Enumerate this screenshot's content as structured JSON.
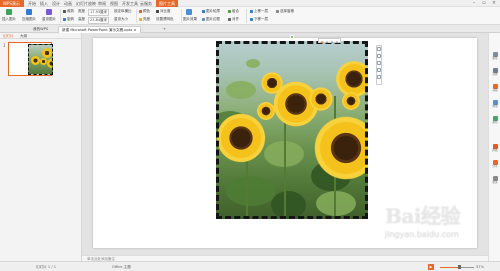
{
  "app": {
    "app_button": "WPS演示",
    "menu_tabs": [
      "开始",
      "插入",
      "设计",
      "动画",
      "幻灯片放映",
      "审阅",
      "视图",
      "开发工具",
      "云服务"
    ],
    "active_tab": "图片工具",
    "accent": "#e8682a"
  },
  "ribbon": {
    "insert_picture": "插入图片",
    "compress": "压缩图片",
    "reset": "重设图片",
    "crop": "裁剪",
    "rotate": "旋转",
    "width_label": "宽度",
    "width_value": "17.93厘米",
    "height_label": "高度",
    "height_value": "23.84厘米",
    "lock_ratio": "锁定纵横比",
    "reset_size": "重设大小",
    "color": "颜色",
    "brightness": "亮度",
    "contrast": "对比度",
    "set_transparent": "设置透明色",
    "effects": "图片效果",
    "outline": "图片轮廓",
    "picture_border": "图片边框",
    "group": "组合",
    "align": "对齐",
    "bring_forward": "上移一层",
    "send_backward": "下移一层",
    "select_pane": "选择窗格"
  },
  "tabs": {
    "home": "我的WPS",
    "doc_active": "新建 Microsoft PowerPoint 演示文稿.pptx",
    "add": "+"
  },
  "left_panel": {
    "tab1": "幻灯片",
    "tab2": "大纲",
    "slide_number": "1"
  },
  "notes": {
    "placeholder": "单击此处添加备注"
  },
  "right_bar": {
    "items": [
      "属性",
      "选择",
      "动画",
      "效果",
      "备份",
      "帮助",
      "分享",
      "更多"
    ]
  },
  "status": {
    "slide_counter": "幻灯片 1 / 1",
    "theme": "Office 主题",
    "zoom": "57%",
    "zoom_fraction": 0.57
  },
  "watermark": {
    "logo": "Bai经验",
    "url": "jingyan.baidu.com"
  }
}
